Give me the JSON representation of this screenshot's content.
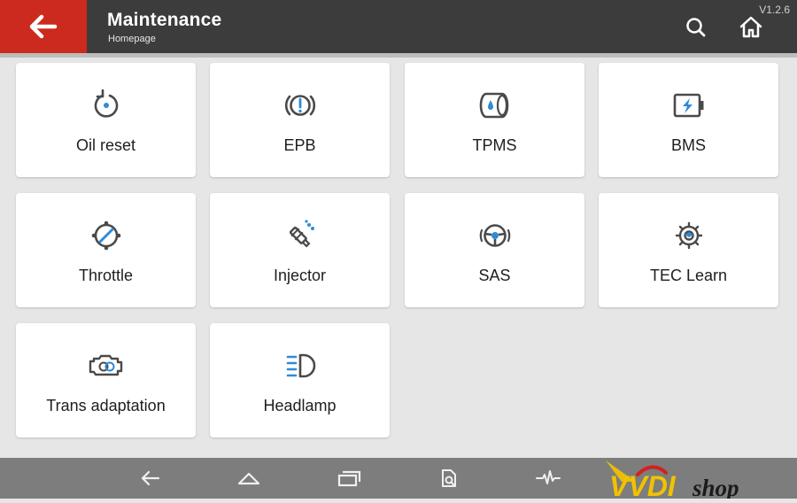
{
  "header": {
    "title": "Maintenance",
    "subtitle": "Homepage",
    "version": "V1.2.6",
    "icons": {
      "back": "arrow-left-icon",
      "search": "search-icon",
      "home": "home-icon"
    }
  },
  "tiles": [
    {
      "label": "Oil reset",
      "icon": "oil-reset-icon"
    },
    {
      "label": "EPB",
      "icon": "parking-brake-icon"
    },
    {
      "label": "TPMS",
      "icon": "tire-pressure-icon"
    },
    {
      "label": "BMS",
      "icon": "battery-icon"
    },
    {
      "label": "Throttle",
      "icon": "throttle-icon"
    },
    {
      "label": "Injector",
      "icon": "injector-icon"
    },
    {
      "label": "SAS",
      "icon": "steering-wheel-icon"
    },
    {
      "label": "TEC Learn",
      "icon": "gear-icon"
    },
    {
      "label": "Trans adaptation",
      "icon": "transmission-icon"
    },
    {
      "label": "Headlamp",
      "icon": "headlamp-icon"
    }
  ],
  "navbar": {
    "icons": [
      "back-nav-icon",
      "home-nav-icon",
      "recents-icon",
      "document-search-icon",
      "waveform-icon"
    ]
  },
  "watermark": {
    "text": "VVDIshop"
  },
  "colors": {
    "accent": "#cc2a1e",
    "header": "#3c3c3c",
    "icon": "#4a4a4a",
    "icon_accent": "#2e8bd8"
  }
}
